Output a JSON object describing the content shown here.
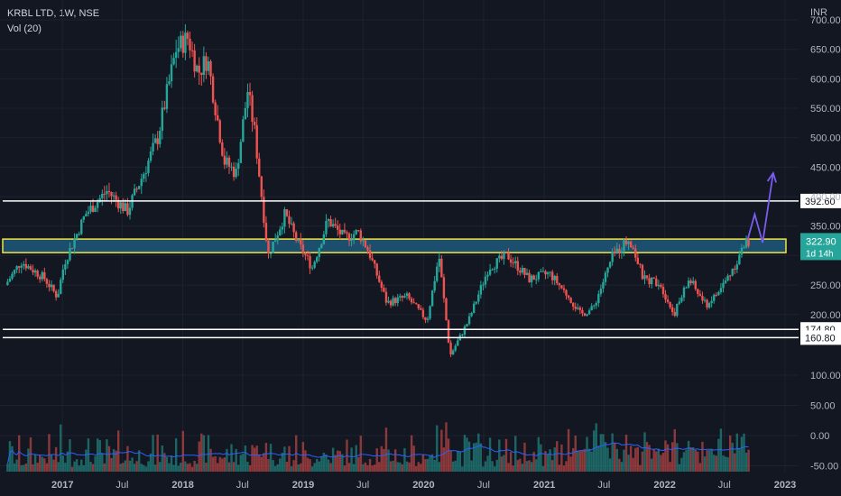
{
  "header": {
    "title": "KRBL LTD, 1W, NSE",
    "volume_label": "Vol (20)",
    "currency": "INR"
  },
  "colors": {
    "background": "#131722",
    "up": "#26a69a",
    "down": "#ef5350",
    "zone_fill": "#1c4f6e",
    "zone_border": "#f0e442",
    "arrow": "#7b5cf0",
    "vol_ma": "#2962ff",
    "axis_text": "#b2b5be",
    "grid": "#1e222d"
  },
  "chart_data": {
    "type": "candlestick",
    "title": "KRBL LTD, 1W, NSE",
    "price_axis": {
      "ticks": [
        700,
        650,
        600,
        550,
        500,
        450,
        400,
        350,
        300,
        250,
        200
      ],
      "range": [
        91,
        703
      ]
    },
    "volume_axis": {
      "ticks": [
        100,
        50,
        0,
        -50
      ],
      "tick_labels": [
        "100.00",
        "50.00",
        "0.00",
        "-50.00"
      ]
    },
    "x_tick_labels": [
      "2017",
      "Jul",
      "2018",
      "Jul",
      "2019",
      "Jul",
      "2020",
      "Jul",
      "2021",
      "Jul",
      "2022",
      "Jul",
      "2023"
    ],
    "x_tick_dates": [
      "2017-01-01",
      "2017-07-01",
      "2018-01-01",
      "2018-07-01",
      "2019-01-01",
      "2019-07-01",
      "2020-01-01",
      "2020-07-01",
      "2021-01-01",
      "2021-07-01",
      "2022-01-01",
      "2022-07-01",
      "2023-01-01"
    ],
    "last_price": {
      "value": 322.9,
      "label": "322.90",
      "countdown": "1d 14h"
    },
    "horizontal_levels": [
      {
        "value": 392.6,
        "label": "392.60",
        "color": "#ffffff"
      },
      {
        "value": 174.8,
        "label": "174.80",
        "color": "#ffffff"
      },
      {
        "value": 160.8,
        "label": "160.80",
        "color": "#ffffff"
      }
    ],
    "zone": {
      "from": 305,
      "to": 328
    },
    "projection": {
      "dates": [
        "2022-09-10",
        "2022-10-01",
        "2022-10-25",
        "2022-11-26"
      ],
      "values": [
        328,
        370,
        322,
        440
      ]
    },
    "price_path": [
      [
        "2016-07-15",
        250
      ],
      [
        "2016-09-01",
        290
      ],
      [
        "2016-11-10",
        262
      ],
      [
        "2016-12-20",
        230
      ],
      [
        "2017-01-10",
        288
      ],
      [
        "2017-03-15",
        370
      ],
      [
        "2017-05-20",
        410
      ],
      [
        "2017-07-20",
        375
      ],
      [
        "2017-09-15",
        450
      ],
      [
        "2017-10-20",
        500
      ],
      [
        "2017-12-15",
        650
      ],
      [
        "2018-01-20",
        670
      ],
      [
        "2018-02-20",
        610
      ],
      [
        "2018-03-20",
        635
      ],
      [
        "2018-05-10",
        460
      ],
      [
        "2018-06-15",
        440
      ],
      [
        "2018-07-20",
        580
      ],
      [
        "2018-08-10",
        510
      ],
      [
        "2018-09-20",
        300
      ],
      [
        "2018-11-10",
        370
      ],
      [
        "2018-12-20",
        320
      ],
      [
        "2019-02-01",
        280
      ],
      [
        "2019-03-20",
        360
      ],
      [
        "2019-05-10",
        330
      ],
      [
        "2019-06-20",
        340
      ],
      [
        "2019-07-20",
        310
      ],
      [
        "2019-09-15",
        220
      ],
      [
        "2019-11-15",
        230
      ],
      [
        "2020-01-15",
        190
      ],
      [
        "2020-02-20",
        300
      ],
      [
        "2020-03-25",
        130
      ],
      [
        "2020-05-20",
        190
      ],
      [
        "2020-07-20",
        280
      ],
      [
        "2020-09-15",
        300
      ],
      [
        "2020-11-20",
        260
      ],
      [
        "2021-01-20",
        270
      ],
      [
        "2021-03-20",
        230
      ],
      [
        "2021-04-25",
        200
      ],
      [
        "2021-06-01",
        210
      ],
      [
        "2021-08-01",
        300
      ],
      [
        "2021-09-20",
        330
      ],
      [
        "2021-11-01",
        260
      ],
      [
        "2021-12-20",
        255
      ],
      [
        "2022-02-01",
        200
      ],
      [
        "2022-03-20",
        260
      ],
      [
        "2022-05-10",
        215
      ],
      [
        "2022-06-20",
        240
      ],
      [
        "2022-08-01",
        280
      ],
      [
        "2022-09-10",
        323
      ]
    ],
    "volume_mentions": "weekly volume histogram with 20-period moving average"
  }
}
